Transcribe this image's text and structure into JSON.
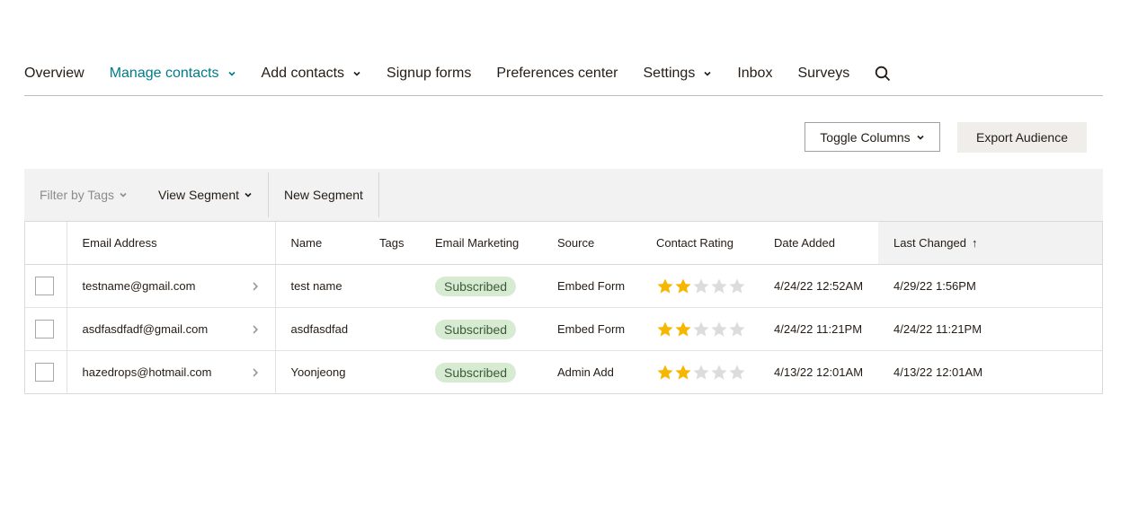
{
  "nav": {
    "items": [
      {
        "label": "Overview",
        "active": false,
        "dropdown": false
      },
      {
        "label": "Manage contacts",
        "active": true,
        "dropdown": true
      },
      {
        "label": "Add contacts",
        "active": false,
        "dropdown": true
      },
      {
        "label": "Signup forms",
        "active": false,
        "dropdown": false
      },
      {
        "label": "Preferences center",
        "active": false,
        "dropdown": false
      },
      {
        "label": "Settings",
        "active": false,
        "dropdown": true
      },
      {
        "label": "Inbox",
        "active": false,
        "dropdown": false
      },
      {
        "label": "Surveys",
        "active": false,
        "dropdown": false
      }
    ],
    "search_icon": "search-icon",
    "active_color": "#007c89"
  },
  "actions": {
    "toggle_columns": "Toggle Columns",
    "export_audience": "Export Audience"
  },
  "filterbar": {
    "filter_by_tags": "Filter by Tags",
    "view_segment": "View Segment",
    "new_segment": "New Segment"
  },
  "table": {
    "headers": {
      "email": "Email Address",
      "name": "Name",
      "tags": "Tags",
      "email_marketing": "Email Marketing",
      "source": "Source",
      "rating": "Contact Rating",
      "date_added": "Date Added",
      "last_changed": "Last Changed",
      "sort_indicator": "↑"
    },
    "rows": [
      {
        "email": "testname@gmail.com",
        "name": "test name",
        "tags": "",
        "status": "Subscribed",
        "source": "Embed Form",
        "rating": 2,
        "date_added": "4/24/22 12:52AM",
        "last_changed": "4/29/22 1:56PM"
      },
      {
        "email": "asdfasdfadf@gmail.com",
        "name": "asdfasdfad",
        "tags": "",
        "status": "Subscribed",
        "source": "Embed Form",
        "rating": 2,
        "date_added": "4/24/22 11:21PM",
        "last_changed": "4/24/22 11:21PM"
      },
      {
        "email": "hazedrops@hotmail.com",
        "name": "Yoonjeong",
        "tags": "",
        "status": "Subscribed",
        "source": "Admin Add",
        "rating": 2,
        "date_added": "4/13/22 12:01AM",
        "last_changed": "4/13/22 12:01AM"
      }
    ],
    "rating_max": 5,
    "star_color": "#f5b700",
    "star_empty_color": "#dcdcdc",
    "badge_color": "#d6ebd2"
  }
}
